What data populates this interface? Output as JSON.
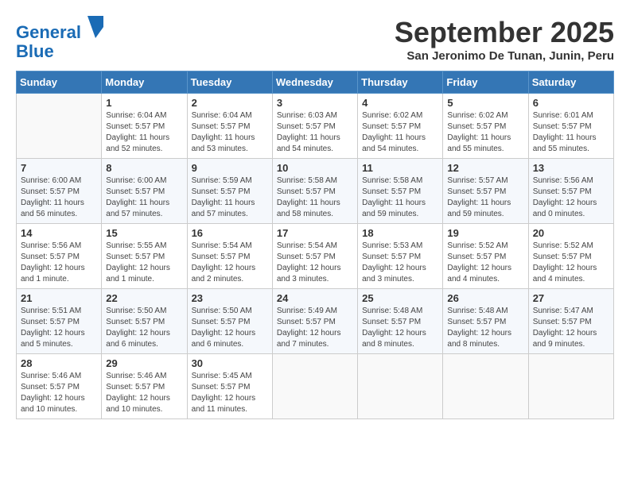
{
  "header": {
    "logo_line1": "General",
    "logo_line2": "Blue",
    "title": "September 2025",
    "location": "San Jeronimo De Tunan, Junin, Peru"
  },
  "days_of_week": [
    "Sunday",
    "Monday",
    "Tuesday",
    "Wednesday",
    "Thursday",
    "Friday",
    "Saturday"
  ],
  "weeks": [
    [
      {
        "day": "",
        "info": ""
      },
      {
        "day": "1",
        "info": "Sunrise: 6:04 AM\nSunset: 5:57 PM\nDaylight: 11 hours\nand 52 minutes."
      },
      {
        "day": "2",
        "info": "Sunrise: 6:04 AM\nSunset: 5:57 PM\nDaylight: 11 hours\nand 53 minutes."
      },
      {
        "day": "3",
        "info": "Sunrise: 6:03 AM\nSunset: 5:57 PM\nDaylight: 11 hours\nand 54 minutes."
      },
      {
        "day": "4",
        "info": "Sunrise: 6:02 AM\nSunset: 5:57 PM\nDaylight: 11 hours\nand 54 minutes."
      },
      {
        "day": "5",
        "info": "Sunrise: 6:02 AM\nSunset: 5:57 PM\nDaylight: 11 hours\nand 55 minutes."
      },
      {
        "day": "6",
        "info": "Sunrise: 6:01 AM\nSunset: 5:57 PM\nDaylight: 11 hours\nand 55 minutes."
      }
    ],
    [
      {
        "day": "7",
        "info": "Sunrise: 6:00 AM\nSunset: 5:57 PM\nDaylight: 11 hours\nand 56 minutes."
      },
      {
        "day": "8",
        "info": "Sunrise: 6:00 AM\nSunset: 5:57 PM\nDaylight: 11 hours\nand 57 minutes."
      },
      {
        "day": "9",
        "info": "Sunrise: 5:59 AM\nSunset: 5:57 PM\nDaylight: 11 hours\nand 57 minutes."
      },
      {
        "day": "10",
        "info": "Sunrise: 5:58 AM\nSunset: 5:57 PM\nDaylight: 11 hours\nand 58 minutes."
      },
      {
        "day": "11",
        "info": "Sunrise: 5:58 AM\nSunset: 5:57 PM\nDaylight: 11 hours\nand 59 minutes."
      },
      {
        "day": "12",
        "info": "Sunrise: 5:57 AM\nSunset: 5:57 PM\nDaylight: 11 hours\nand 59 minutes."
      },
      {
        "day": "13",
        "info": "Sunrise: 5:56 AM\nSunset: 5:57 PM\nDaylight: 12 hours\nand 0 minutes."
      }
    ],
    [
      {
        "day": "14",
        "info": "Sunrise: 5:56 AM\nSunset: 5:57 PM\nDaylight: 12 hours\nand 1 minute."
      },
      {
        "day": "15",
        "info": "Sunrise: 5:55 AM\nSunset: 5:57 PM\nDaylight: 12 hours\nand 1 minute."
      },
      {
        "day": "16",
        "info": "Sunrise: 5:54 AM\nSunset: 5:57 PM\nDaylight: 12 hours\nand 2 minutes."
      },
      {
        "day": "17",
        "info": "Sunrise: 5:54 AM\nSunset: 5:57 PM\nDaylight: 12 hours\nand 3 minutes."
      },
      {
        "day": "18",
        "info": "Sunrise: 5:53 AM\nSunset: 5:57 PM\nDaylight: 12 hours\nand 3 minutes."
      },
      {
        "day": "19",
        "info": "Sunrise: 5:52 AM\nSunset: 5:57 PM\nDaylight: 12 hours\nand 4 minutes."
      },
      {
        "day": "20",
        "info": "Sunrise: 5:52 AM\nSunset: 5:57 PM\nDaylight: 12 hours\nand 4 minutes."
      }
    ],
    [
      {
        "day": "21",
        "info": "Sunrise: 5:51 AM\nSunset: 5:57 PM\nDaylight: 12 hours\nand 5 minutes."
      },
      {
        "day": "22",
        "info": "Sunrise: 5:50 AM\nSunset: 5:57 PM\nDaylight: 12 hours\nand 6 minutes."
      },
      {
        "day": "23",
        "info": "Sunrise: 5:50 AM\nSunset: 5:57 PM\nDaylight: 12 hours\nand 6 minutes."
      },
      {
        "day": "24",
        "info": "Sunrise: 5:49 AM\nSunset: 5:57 PM\nDaylight: 12 hours\nand 7 minutes."
      },
      {
        "day": "25",
        "info": "Sunrise: 5:48 AM\nSunset: 5:57 PM\nDaylight: 12 hours\nand 8 minutes."
      },
      {
        "day": "26",
        "info": "Sunrise: 5:48 AM\nSunset: 5:57 PM\nDaylight: 12 hours\nand 8 minutes."
      },
      {
        "day": "27",
        "info": "Sunrise: 5:47 AM\nSunset: 5:57 PM\nDaylight: 12 hours\nand 9 minutes."
      }
    ],
    [
      {
        "day": "28",
        "info": "Sunrise: 5:46 AM\nSunset: 5:57 PM\nDaylight: 12 hours\nand 10 minutes."
      },
      {
        "day": "29",
        "info": "Sunrise: 5:46 AM\nSunset: 5:57 PM\nDaylight: 12 hours\nand 10 minutes."
      },
      {
        "day": "30",
        "info": "Sunrise: 5:45 AM\nSunset: 5:57 PM\nDaylight: 12 hours\nand 11 minutes."
      },
      {
        "day": "",
        "info": ""
      },
      {
        "day": "",
        "info": ""
      },
      {
        "day": "",
        "info": ""
      },
      {
        "day": "",
        "info": ""
      }
    ]
  ]
}
